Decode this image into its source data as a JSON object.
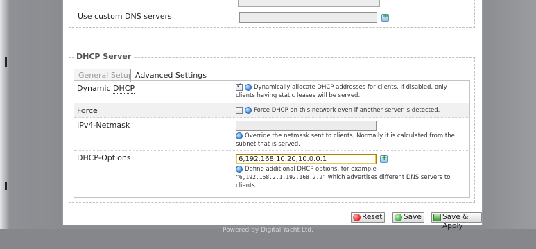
{
  "top_section": {
    "custom_dns_label": "Use custom DNS servers",
    "custom_dns_value": ""
  },
  "dhcp": {
    "legend": "DHCP Server",
    "tabs": [
      {
        "label": "General Setup",
        "active": false
      },
      {
        "label": "Advanced Settings",
        "active": true
      }
    ],
    "dynamic_dhcp": {
      "label_prefix": "Dynamic ",
      "label_abbr": "DHCP",
      "checked": true,
      "description": "Dynamically allocate DHCP addresses for clients. If disabled, only clients having static leases will be served."
    },
    "force": {
      "label": "Force",
      "checked": false,
      "description": "Force DHCP on this network even if another server is detected."
    },
    "netmask": {
      "label_abbr": "IPv4",
      "label_suffix": "-Netmask",
      "value": "",
      "description": "Override the netmask sent to clients. Normally it is calculated from the subnet that is served."
    },
    "options": {
      "label": "DHCP-Options",
      "value": "6,192.168.10.20,10.0.0.1",
      "desc_line1": "Define additional DHCP options, for example",
      "desc_code": "\"6,192.168.2.1,192.168.2.2\"",
      "desc_line2": " which advertises different DNS servers to",
      "desc_line3": "clients."
    }
  },
  "buttons": {
    "reset": "Reset",
    "save": "Save",
    "save_apply": "Save & Apply"
  },
  "footer": "Powered by Digital Yacht Ltd.",
  "colors": {
    "backdrop": "#8b8d91",
    "card": "#ffffff",
    "shaded_row": "#f1f1f1",
    "help_icon": "#3b86d8"
  }
}
